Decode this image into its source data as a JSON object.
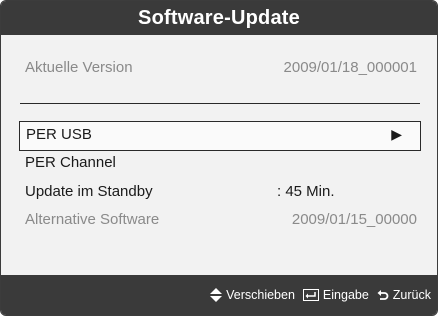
{
  "window": {
    "title": "Software-Update"
  },
  "info": {
    "version_label": "Aktuelle Version",
    "version_value": "2009/01/18_000001"
  },
  "menu": {
    "items": [
      {
        "label": "PER USB",
        "selected": true,
        "arrow": "▶"
      },
      {
        "label": "PER Channel"
      },
      {
        "label": "Update im Standby",
        "value": ": 45 Min."
      },
      {
        "label": "Alternative Software",
        "value": "2009/01/15_00000",
        "disabled": true
      }
    ]
  },
  "footer": {
    "move_label": "Verschieben",
    "enter_label": "Eingabe",
    "back_label": "Zurück",
    "icons": {
      "move": "up-down-arrow-icon",
      "enter": "enter-icon",
      "back": "return-icon"
    }
  },
  "colors": {
    "title_bar_bg": "#3a3a3a",
    "panel_bg": "#f2f2f2",
    "text": "#1a1a1a",
    "disabled_text": "#8a8a8a"
  }
}
